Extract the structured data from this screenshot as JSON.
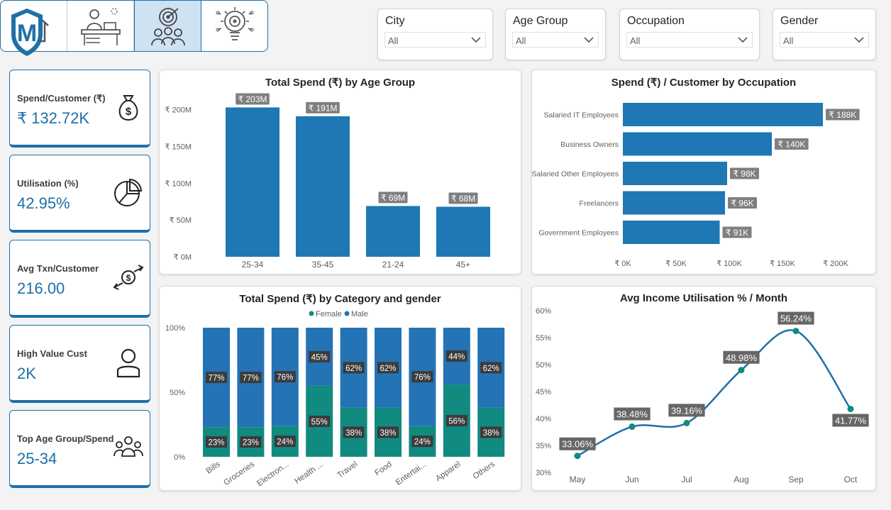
{
  "nav": {
    "logo_letter": "M",
    "buttons": [
      {
        "name": "home-icon",
        "active": false
      },
      {
        "name": "desk-worker-icon",
        "active": false
      },
      {
        "name": "target-audience-icon",
        "active": true
      },
      {
        "name": "lightbulb-gear-icon",
        "active": false
      }
    ]
  },
  "slicers": [
    {
      "title": "City",
      "value": "All"
    },
    {
      "title": "Age Group",
      "value": "All"
    },
    {
      "title": "Occupation",
      "value": "All"
    },
    {
      "title": "Gender",
      "value": "All"
    }
  ],
  "kpis": [
    {
      "label": "Spend/Customer (₹)",
      "value": "₹ 132.72K",
      "icon": "money-bag-icon"
    },
    {
      "label": "Utilisation (%)",
      "value": "42.95%",
      "icon": "pie-chart-icon"
    },
    {
      "label": "Avg Txn/Customer",
      "value": "216.00",
      "icon": "money-exchange-icon"
    },
    {
      "label": "High Value Cust",
      "value": "2K",
      "icon": "user-icon"
    },
    {
      "label": "Top Age Group/Spend",
      "value": "25-34",
      "icon": "group-icon"
    }
  ],
  "chart_data": [
    {
      "type": "bar",
      "title": "Total Spend (₹) by Age Group",
      "categories": [
        "25-34",
        "35-45",
        "21-24",
        "45+"
      ],
      "values": [
        203,
        191,
        69,
        68
      ],
      "data_labels": [
        "₹ 203M",
        "₹ 191M",
        "₹ 69M",
        "₹ 68M"
      ],
      "y_ticks": [
        "₹ 0M",
        "₹ 50M",
        "₹ 100M",
        "₹ 150M",
        "₹ 200M"
      ],
      "ylim": [
        0,
        215
      ],
      "color": "#1f77b4"
    },
    {
      "type": "bar",
      "orientation": "horizontal",
      "title": "Spend (₹) / Customer by Occupation",
      "categories": [
        "Salaried IT Employees",
        "Business Owners",
        "Salaried Other Employees",
        "Freelancers",
        "Government Employees"
      ],
      "values": [
        188,
        140,
        98,
        96,
        91
      ],
      "data_labels": [
        "₹ 188K",
        "₹ 140K",
        "₹ 98K",
        "₹ 96K",
        "₹ 91K"
      ],
      "x_ticks": [
        "₹ 0K",
        "₹ 50K",
        "₹ 100K",
        "₹ 150K",
        "₹ 200K"
      ],
      "xlim": [
        0,
        200
      ],
      "color": "#1f77b4"
    },
    {
      "type": "bar",
      "stacked": "100%",
      "title": "Total Spend (₹) by Category and gender",
      "categories": [
        "Bills",
        "Groceries",
        "Electron...",
        "Health ...",
        "Travel",
        "Food",
        "Entertai...",
        "Apparel",
        "Others"
      ],
      "series": [
        {
          "name": "Female",
          "values": [
            23,
            23,
            24,
            55,
            38,
            38,
            24,
            56,
            38
          ],
          "color": "#118a80"
        },
        {
          "name": "Male",
          "values": [
            77,
            77,
            76,
            45,
            62,
            62,
            76,
            44,
            62
          ],
          "color": "#2473b5"
        }
      ],
      "y_ticks": [
        "0%",
        "50%",
        "100%"
      ],
      "ylim": [
        0,
        100
      ],
      "legend": "top-center"
    },
    {
      "type": "line",
      "title": "Avg Income Utilisation % / Month",
      "x": [
        "May",
        "Jun",
        "Jul",
        "Aug",
        "Sep",
        "Oct"
      ],
      "values": [
        33.06,
        38.48,
        39.16,
        48.98,
        56.24,
        41.77
      ],
      "data_labels": [
        "33.06%",
        "38.48%",
        "39.16%",
        "48.98%",
        "56.24%",
        "41.77%"
      ],
      "y_ticks": [
        "30%",
        "35%",
        "40%",
        "45%",
        "50%",
        "55%",
        "60%"
      ],
      "ylim": [
        30,
        60
      ],
      "color": "#1f6fa8",
      "marker_color": "#118a80"
    }
  ]
}
